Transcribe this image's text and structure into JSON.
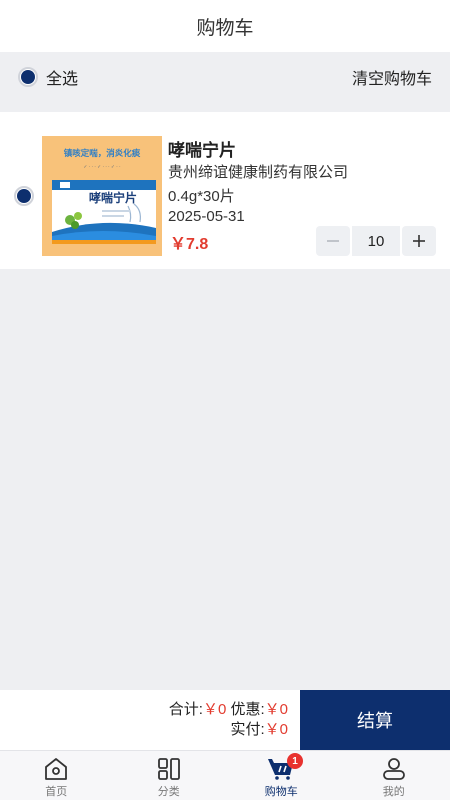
{
  "header": {
    "title": "购物车"
  },
  "toolbar": {
    "select_all_label": "全选",
    "clear_cart_label": "清空购物车"
  },
  "cart": {
    "items": [
      {
        "name": "哮喘宁片",
        "manufacturer": "贵州缔谊健康制药有限公司",
        "spec": "0.4g*30片",
        "expiry": "2025-05-31",
        "price": "￥7.8",
        "quantity": "10",
        "image": {
          "slogan": "镇咳定喘，消炎化痰",
          "box_title": "哮喘宁片"
        }
      }
    ]
  },
  "checkout": {
    "total_label": "合计:",
    "total_value": "￥0",
    "discount_label": "优惠:",
    "discount_value": "￥0",
    "paid_label": "实付:",
    "paid_value": "￥0",
    "button_label": "结算"
  },
  "tabbar": {
    "tabs": [
      {
        "label": "首页",
        "icon": "home-icon"
      },
      {
        "label": "分类",
        "icon": "category-icon"
      },
      {
        "label": "购物车",
        "icon": "cart-icon",
        "badge": "1",
        "active": true
      },
      {
        "label": "我的",
        "icon": "user-icon"
      }
    ]
  },
  "colors": {
    "accent": "#0d2f6e",
    "price": "#e23c2f",
    "badge": "#e8322f",
    "background": "#eeeff2"
  }
}
